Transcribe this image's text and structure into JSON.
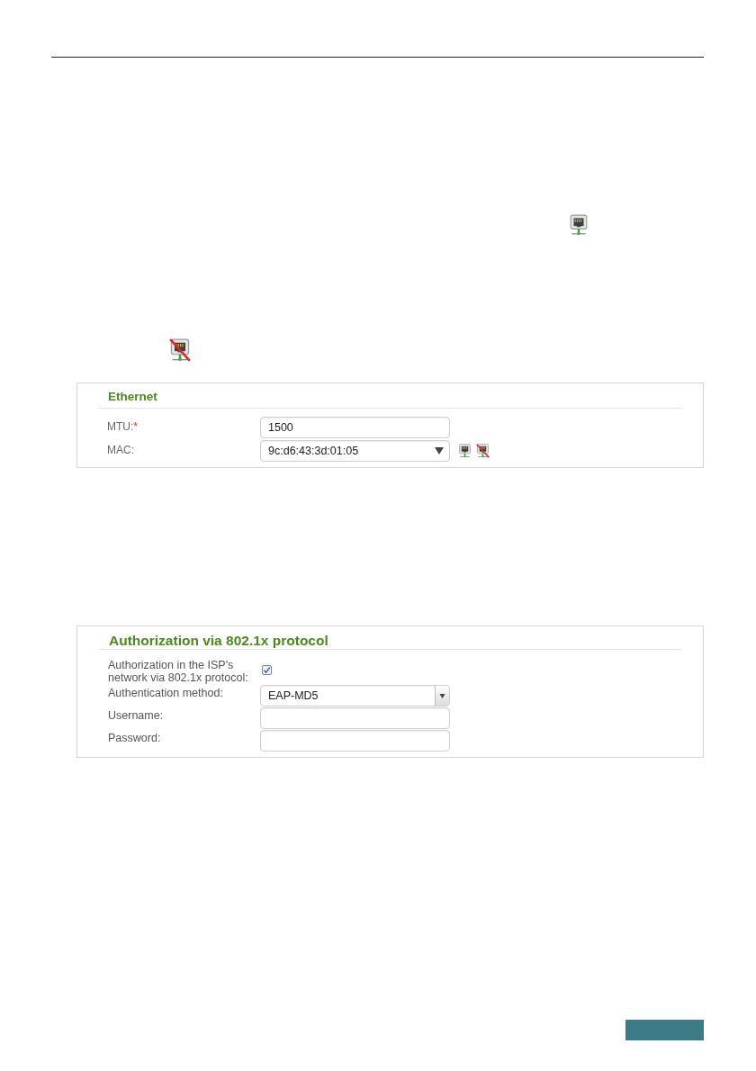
{
  "ethernet_panel": {
    "title": "Ethernet",
    "fields": [
      {
        "kind": "text",
        "label": "MTU:",
        "required_mark": "*",
        "value": "1500"
      },
      {
        "kind": "combobox",
        "label": "MAC:",
        "value": "9c:d6:43:3d:01:05"
      }
    ]
  },
  "auth_panel": {
    "title": "Authorization via 802.1x protocol",
    "fields": [
      {
        "kind": "checkbox",
        "label": "Authorization in the ISP's network via 802.1x protocol:",
        "checked": true
      },
      {
        "kind": "dropdown",
        "label": "Authentication method:",
        "value": "EAP-MD5"
      },
      {
        "kind": "text",
        "label": "Username:"
      },
      {
        "kind": "password",
        "label": "Password:"
      }
    ]
  }
}
